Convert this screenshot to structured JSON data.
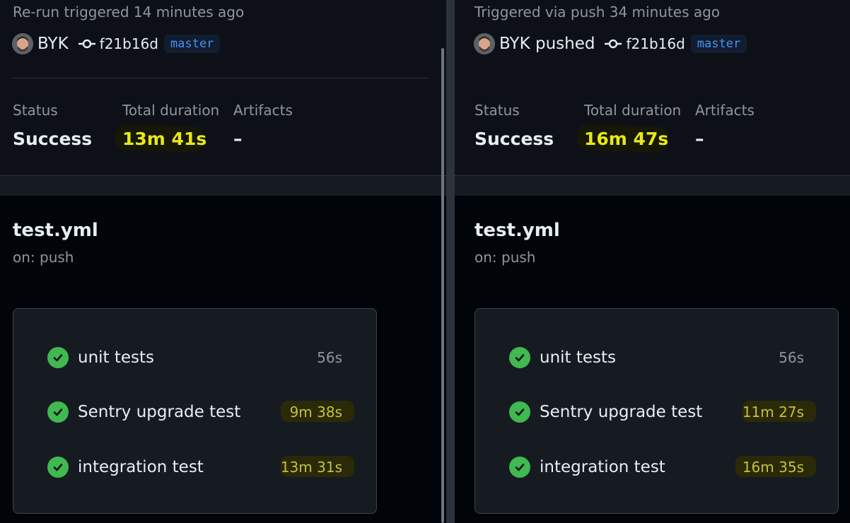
{
  "left": {
    "trigger_text": "Re-run triggered 14 minutes ago",
    "actor": "BYK",
    "sha": "f21b16d",
    "branch": "master",
    "status_label": "Status",
    "status_value": "Success",
    "duration_label": "Total duration",
    "duration_value": "13m 41s",
    "artifacts_label": "Artifacts",
    "artifacts_value": "–",
    "workflow_title": "test.yml",
    "workflow_trigger": "on: push",
    "jobs": [
      {
        "name": "unit tests",
        "duration": "56s"
      },
      {
        "name": "Sentry upgrade test",
        "duration": "9m 38s"
      },
      {
        "name": "integration test",
        "duration": "13m 31s"
      }
    ]
  },
  "right": {
    "trigger_text": "Triggered via push 34 minutes ago",
    "actor": "BYK pushed",
    "sha": "f21b16d",
    "branch": "master",
    "status_label": "Status",
    "status_value": "Success",
    "duration_label": "Total duration",
    "duration_value": "16m 47s",
    "artifacts_label": "Artifacts",
    "artifacts_value": "–",
    "workflow_title": "test.yml",
    "workflow_trigger": "on: push",
    "jobs": [
      {
        "name": "unit tests",
        "duration": "56s"
      },
      {
        "name": "Sentry upgrade test",
        "duration": "11m 27s"
      },
      {
        "name": "integration test",
        "duration": "16m 35s"
      }
    ]
  },
  "colors": {
    "success": "#3fb950",
    "highlight": "#e8e81a",
    "branch_text": "#4493f8"
  }
}
